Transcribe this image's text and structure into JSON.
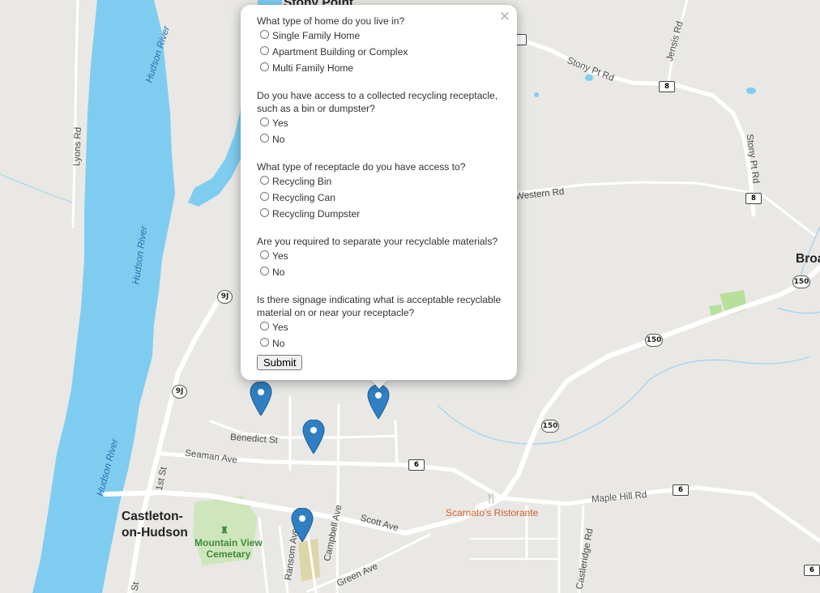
{
  "colors": {
    "water": "#7ecdf0",
    "land": "#e9e8e5",
    "road": "#ffffff",
    "park": "#c6e5b0",
    "marker": "#2f7fc2",
    "popup_bg": "#ffffff"
  },
  "map": {
    "place_labels": {
      "stony_point": "Stony Point",
      "castleton": "Castleton-\non-Hudson",
      "broad": "Broa"
    },
    "river_labels": [
      "Hudson River",
      "Hudson River",
      "Hudson River"
    ],
    "road_labels": {
      "lyons_rd": "Lyons Rd",
      "stony_pt_rd_1": "Stony Pt Rd",
      "stony_pt_rd_2": "Stony Pt Rd",
      "jensis_rd": "Jensis Rd",
      "western_rd": "Western Rd",
      "benedict_st": "Benedict St",
      "seaman_ave": "Seaman Ave",
      "first_st": "1st St",
      "scott_ave": "Scott Ave",
      "campbell_ave": "Campbell Ave",
      "ransom_ave": "Ransom Ave",
      "green_ave": "Green Ave",
      "maple_hill_rd": "Maple Hill Rd",
      "castleridge_rd": "Castleridge Rd",
      "st_fragment": "St"
    },
    "poi": {
      "cemetery": "Mountain View\nCemetary",
      "restaurant": "Scarnato's Ristorante"
    },
    "shields": {
      "r8": "8",
      "r9j": "9J",
      "r150": "150",
      "r6": "6"
    },
    "icons": {
      "marker": "map-pin-icon",
      "restaurant": "fork-knife-icon",
      "cemetery": "cemetery-icon"
    }
  },
  "popup": {
    "close": "×",
    "q1": {
      "text": "What type of home do you live in?",
      "options": [
        "Single Family Home",
        "Apartment Building or Complex",
        "Multi Family Home"
      ]
    },
    "q2": {
      "text": "Do you have access to a collected recycling receptacle, such as a bin or dumpster?",
      "options": [
        "Yes",
        "No"
      ]
    },
    "q3": {
      "text": "What type of receptacle do you have access to?",
      "options": [
        "Recycling Bin",
        "Recycling Can",
        "Recycling Dumpster"
      ]
    },
    "q4": {
      "text": "Are you required to separate your recyclable materials?",
      "options": [
        "Yes",
        "No"
      ]
    },
    "q5": {
      "text": "Is there signage indicating what is acceptable recyclable material on or near your receptacle?",
      "options": [
        "Yes",
        "No"
      ]
    },
    "submit": "Submit"
  }
}
